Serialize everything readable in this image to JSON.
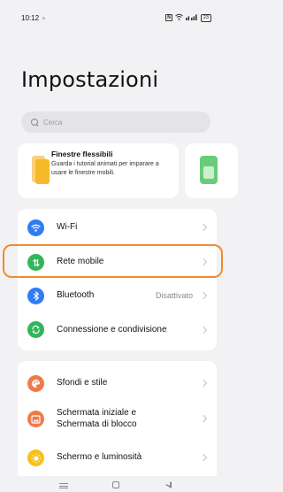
{
  "status_bar": {
    "time": "10:12",
    "nfc_icon": "N",
    "battery": "23"
  },
  "page": {
    "title": "Impostazioni"
  },
  "search": {
    "placeholder": "Cerca"
  },
  "tip_card": {
    "title": "Finestre flessibili",
    "description": "Guarda i tutorial animati per imparare a usare le finestre mobili."
  },
  "group1": [
    {
      "label": "Wi-Fi",
      "icon": "wifi-icon",
      "color": "#2f7cf6",
      "value": ""
    },
    {
      "label": "Rete mobile",
      "icon": "mobile-data-icon",
      "color": "#33b55b",
      "value": ""
    },
    {
      "label": "Bluetooth",
      "icon": "bluetooth-icon",
      "color": "#2f7cf6",
      "value": "Disattivato"
    },
    {
      "label": "Connessione e condivisione",
      "icon": "connection-sharing-icon",
      "color": "#33b55b",
      "value": ""
    }
  ],
  "group2": [
    {
      "label": "Sfondi e stile",
      "icon": "palette-icon",
      "color": "#f07a4a"
    },
    {
      "label": "Schermata iniziale e Schermata di blocco",
      "label_line1": "Schermata iniziale e",
      "label_line2": "Schermata di blocco",
      "icon": "home-screen-icon",
      "color": "#f07a4a"
    },
    {
      "label": "Schermo e luminosità",
      "icon": "brightness-icon",
      "color": "#f5c21a"
    }
  ],
  "colors": {
    "highlight": "#f08c2b",
    "background": "#f2f2f4"
  }
}
